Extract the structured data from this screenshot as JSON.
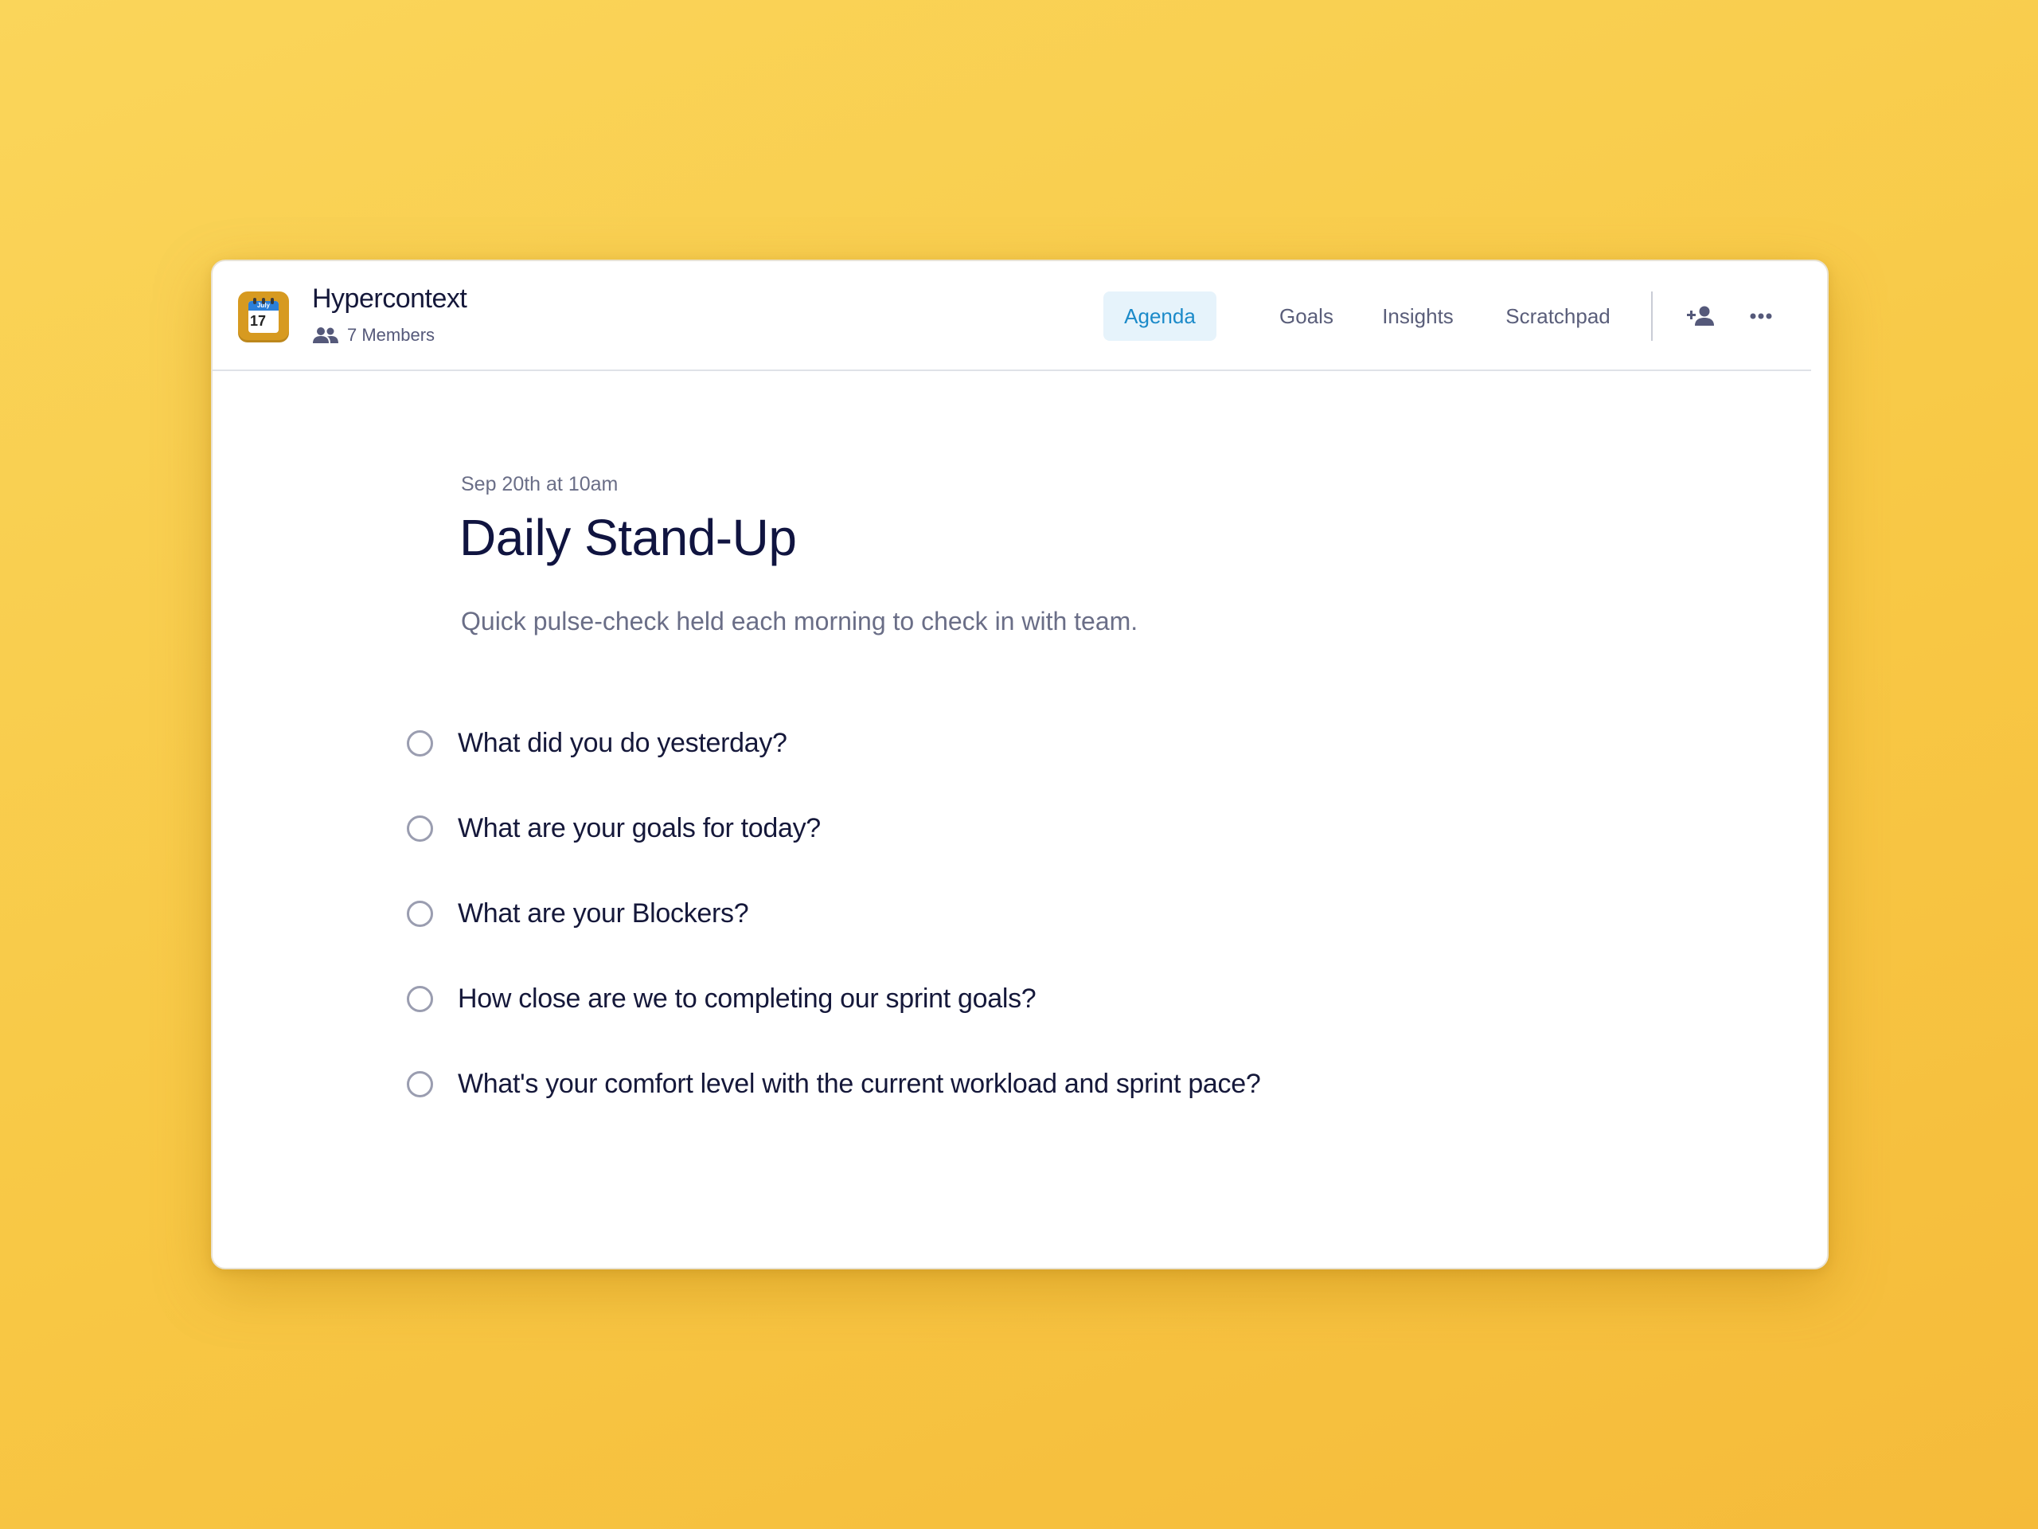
{
  "app": {
    "name": "Hypercontext",
    "members_label": "7 Members",
    "icon": "calendar-icon",
    "icon_month": "July",
    "icon_day": "17"
  },
  "nav": {
    "tabs": [
      {
        "label": "Agenda",
        "active": true
      },
      {
        "label": "Goals",
        "active": false
      },
      {
        "label": "Insights",
        "active": false
      },
      {
        "label": "Scratchpad",
        "active": false
      }
    ],
    "actions": [
      "add-person-icon",
      "more-horizontal-icon"
    ]
  },
  "meeting": {
    "date": "Sep 20th at 10am",
    "title": "Daily Stand-Up",
    "description": "Quick pulse-check held each morning to check in with team."
  },
  "agenda_items": [
    {
      "text": "What did you do yesterday?",
      "checked": false
    },
    {
      "text": "What are your goals for today?",
      "checked": false
    },
    {
      "text": "What are your Blockers?",
      "checked": false
    },
    {
      "text": "How close are we to completing our sprint goals?",
      "checked": false
    },
    {
      "text": "What's your comfort level with the current workload and sprint pace?",
      "checked": false
    }
  ],
  "colors": {
    "background": "#f8c845",
    "accent": "#1b8ac9",
    "active_tab_bg": "#e6f3fb",
    "heading": "#101440",
    "muted": "#6a6e87"
  }
}
